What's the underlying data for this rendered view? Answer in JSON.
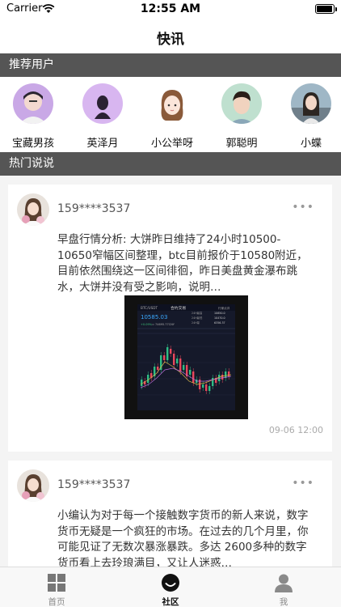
{
  "status_bar": {
    "carrier": "Carrier",
    "time": "12:55 AM",
    "battery_level": 0.95
  },
  "nav": {
    "title": "快讯"
  },
  "recommended": {
    "header": "推荐用户",
    "users": [
      {
        "name": "宝藏男孩"
      },
      {
        "name": "英泽月"
      },
      {
        "name": "小公举呀"
      },
      {
        "name": "郭聪明"
      },
      {
        "name": "小蝶"
      }
    ]
  },
  "hot": {
    "header": "热门说说",
    "posts": [
      {
        "username": "159****3537",
        "more": "•••",
        "content": "早盘行情分析: 大饼昨日维持了24小时10500-10650窄幅区间整理，btc目前报价于10580附近，目前依然围绕这一区间徘徊，昨日美盘黄金瀑布跳水，大饼并没有受之影响，说明…",
        "timestamp": "09-06 12:00",
        "chart_image": {
          "header_title": "合约交易",
          "pair": "BTC/USDT",
          "right_action": "行家点评",
          "price": "10585.03",
          "stats": [
            {
              "label": "24H最高",
              "value": "10650.0"
            },
            {
              "label": "24H最低",
              "value": "10470.0"
            },
            {
              "label": "24H量",
              "value": "6356.37"
            }
          ],
          "change": "+0.09%",
          "cny": "≈ 74695.77CNY"
        }
      },
      {
        "username": "159****3537",
        "more": "•••",
        "content": "小编认为对于每一个接触数字货币的新人来说，数字货币无疑是一个疯狂的市场。在过去的几个月里，你可能见证了无数次暴涨暴跌。多达 2600多种的数字货币看上去玲琅满目，又让人迷惑…"
      }
    ]
  },
  "tabs": [
    {
      "label": "首页",
      "icon": "grid-icon"
    },
    {
      "label": "社区",
      "icon": "smile-icon"
    },
    {
      "label": "我",
      "icon": "person-icon"
    }
  ]
}
